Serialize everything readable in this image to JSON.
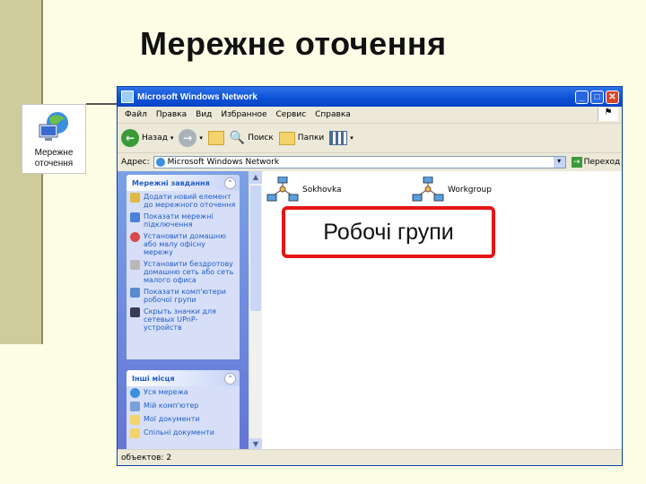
{
  "slide": {
    "title": "Мережне оточення",
    "callout": "Робочі групи"
  },
  "desktop_icon": {
    "label_line1": "Мережне",
    "label_line2": "оточення",
    "icon": "network-places-icon"
  },
  "window": {
    "title": "Microsoft Windows Network",
    "menu": [
      "Файл",
      "Правка",
      "Вид",
      "Избранное",
      "Сервис",
      "Справка"
    ],
    "toolbar": {
      "back": "Назад",
      "search": "Поиск",
      "folders": "Папки"
    },
    "address_label": "Адрес:",
    "address_value": "Microsoft Windows Network",
    "go_label": "Переход",
    "status": "объектов: 2"
  },
  "tasks_panel": {
    "title": "Мережні завдання",
    "items": [
      "Додати новий елемент до мережного оточення",
      "Показати мережні підключення",
      "Установити домашню або малу офісну мережу",
      "Установити бездротову домашню сеть або сеть малого офиса",
      "Показати комп'ютери робочої групи",
      "Скрыть значки для сетевых UPnP-устройств"
    ]
  },
  "other_panel": {
    "title": "Інші місця",
    "items": [
      "Уся мережа",
      "Мій комп'ютер",
      "Мої документи",
      "Спільні документи"
    ]
  },
  "content_items": [
    "Sokhovka",
    "Workgroup"
  ],
  "colors": {
    "title_bar": "#0a4fd6",
    "callout_border": "#e51515",
    "panel_bg": "#6f8ee0"
  }
}
